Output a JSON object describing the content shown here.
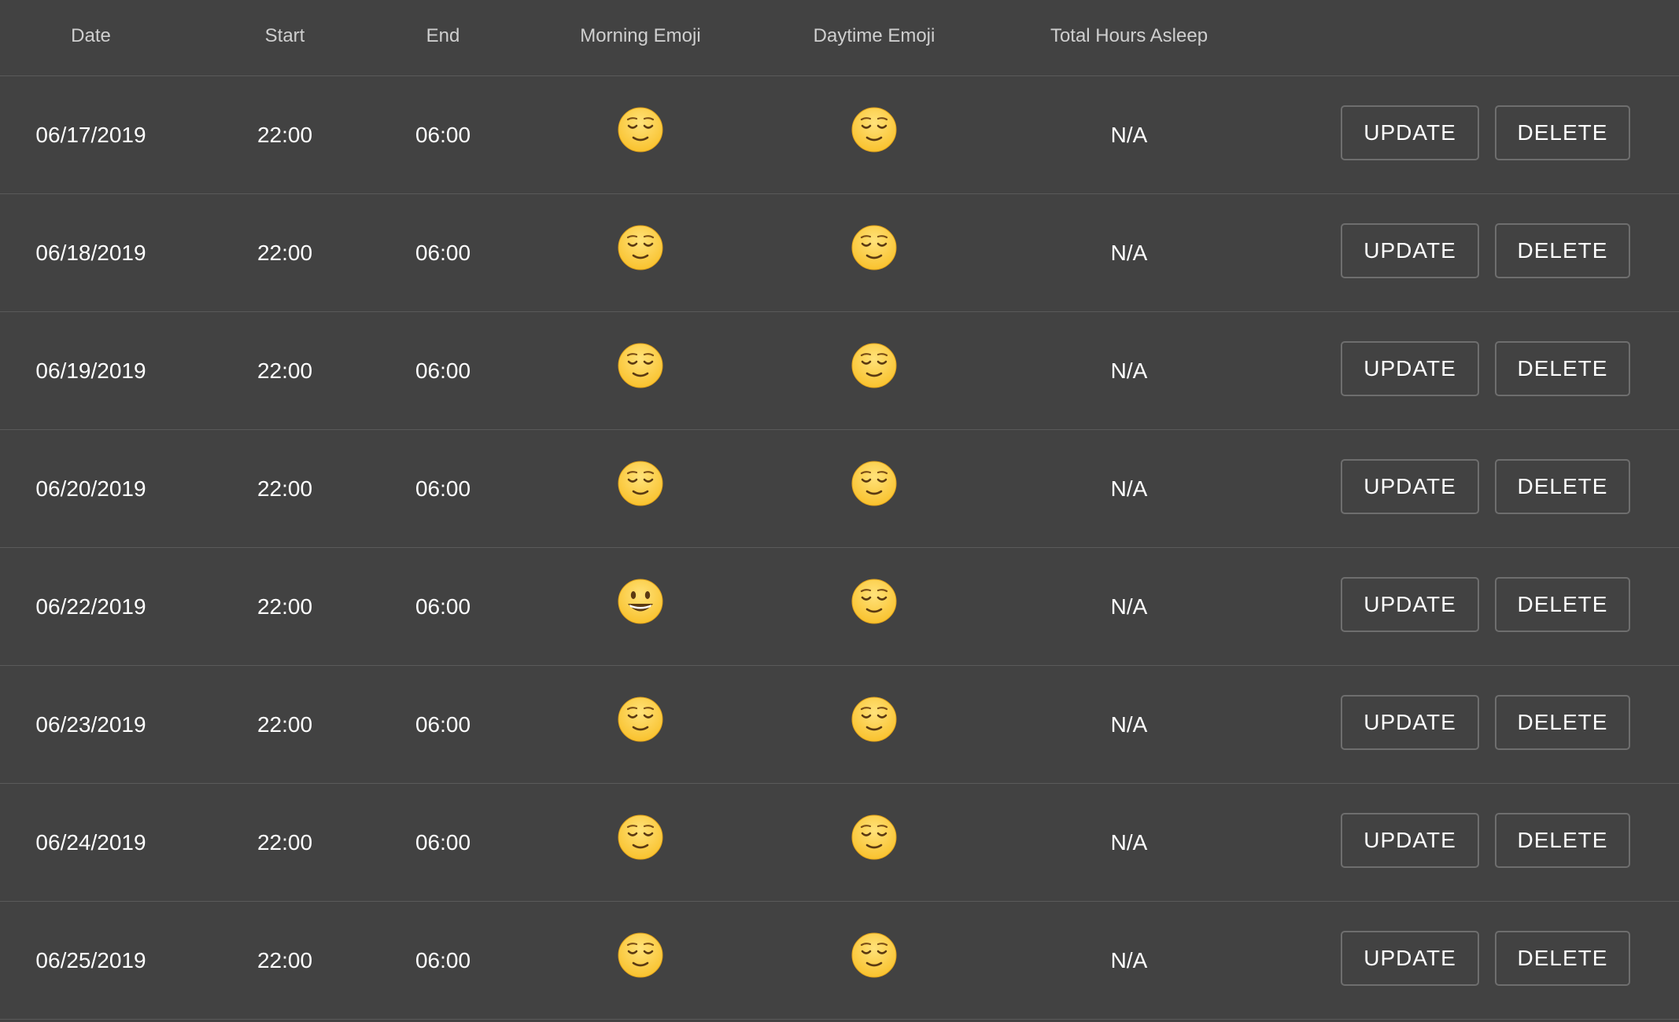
{
  "header": {
    "date": "Date",
    "start": "Start",
    "end": "End",
    "morning_emoji": "Morning Emoji",
    "daytime_emoji": "Daytime Emoji",
    "total_hours": "Total Hours Asleep"
  },
  "buttons": {
    "update": "UPDATE",
    "delete": "DELETE"
  },
  "colors": {
    "background": "#424242",
    "divider": "#5a5a5a",
    "emoji_face": "#f9c22e"
  },
  "rows": [
    {
      "date": "06/17/2019",
      "start": "22:00",
      "end": "06:00",
      "morning": "relieved-face",
      "daytime": "relieved-face",
      "total": "N/A"
    },
    {
      "date": "06/18/2019",
      "start": "22:00",
      "end": "06:00",
      "morning": "relieved-face",
      "daytime": "relieved-face",
      "total": "N/A"
    },
    {
      "date": "06/19/2019",
      "start": "22:00",
      "end": "06:00",
      "morning": "relieved-face",
      "daytime": "relieved-face",
      "total": "N/A"
    },
    {
      "date": "06/20/2019",
      "start": "22:00",
      "end": "06:00",
      "morning": "relieved-face",
      "daytime": "relieved-face",
      "total": "N/A"
    },
    {
      "date": "06/22/2019",
      "start": "22:00",
      "end": "06:00",
      "morning": "grinning-face",
      "daytime": "relieved-face",
      "total": "N/A"
    },
    {
      "date": "06/23/2019",
      "start": "22:00",
      "end": "06:00",
      "morning": "relieved-face",
      "daytime": "relieved-face",
      "total": "N/A"
    },
    {
      "date": "06/24/2019",
      "start": "22:00",
      "end": "06:00",
      "morning": "relieved-face",
      "daytime": "relieved-face",
      "total": "N/A"
    },
    {
      "date": "06/25/2019",
      "start": "22:00",
      "end": "06:00",
      "morning": "relieved-face",
      "daytime": "relieved-face",
      "total": "N/A"
    }
  ]
}
